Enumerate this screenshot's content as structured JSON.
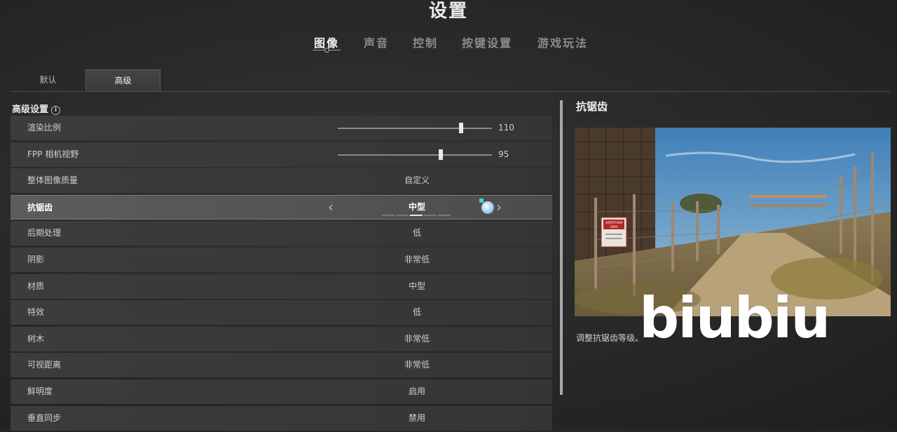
{
  "page_title": "设置",
  "main_tabs": [
    "图像",
    "声音",
    "控制",
    "按键设置",
    "游戏玩法"
  ],
  "active_main_tab": "图像",
  "sub_tabs": [
    "默认",
    "高级"
  ],
  "active_sub_tab": "高级",
  "section_title": "高级设置",
  "info_icon_glyph": "i",
  "sliders": [
    {
      "label": "渲染比例",
      "value": "110",
      "fraction": 0.8
    },
    {
      "label": "FPP 相机视野",
      "value": "95",
      "fraction": 0.67
    }
  ],
  "rows": [
    {
      "label": "整体图像质量",
      "value": "自定义"
    },
    {
      "label": "抗锯齿",
      "value": "中型",
      "selected": true,
      "level": 3,
      "level_max": 5,
      "prev_arrow": "‹",
      "next_arrow": "›"
    },
    {
      "label": "后期处理",
      "value": "低"
    },
    {
      "label": "阴影",
      "value": "非常低"
    },
    {
      "label": "材质",
      "value": "中型"
    },
    {
      "label": "特效",
      "value": "低"
    },
    {
      "label": "树木",
      "value": "非常低"
    },
    {
      "label": "可视距离",
      "value": "非常低"
    },
    {
      "label": "鲜明度",
      "value": "启用"
    },
    {
      "label": "垂直同步",
      "value": "禁用"
    }
  ],
  "detail": {
    "title": "抗锯齿",
    "description": "调整抗锯齿等级。",
    "sign_lines": [
      "ЗАПРЕТНАЯ",
      "ЗОНА"
    ]
  },
  "watermark": "biubiu",
  "colors": {
    "accent": "#f2f2f2",
    "panel": "#3a3a3a",
    "selected_row": "#555555"
  }
}
